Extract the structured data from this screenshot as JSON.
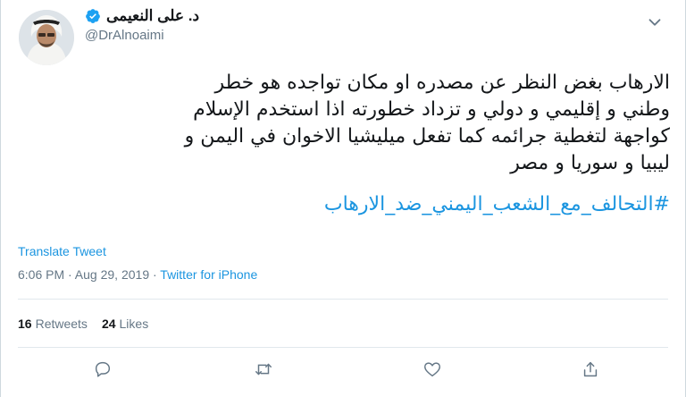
{
  "author": {
    "name": "د. على النعيمى",
    "handle": "@DrAlnoaimi"
  },
  "tweet": {
    "lines": [
      "الارهاب بغض النظر عن مصدره او مكان تواجده  هو خطر",
      "وطني و إقليمي و دولي و تزداد خطورته اذا  استخدم الإسلام",
      "كواجهة لتغطية جرائمه  كما تفعل ميليشيا الاخوان في اليمن و",
      "ليبيا و سوريا و مصر"
    ],
    "hashtag": "#التحالف_مع_الشعب_اليمني_ضد_الارهاب"
  },
  "translate_label": "Translate Tweet",
  "meta": {
    "time": "6:06 PM · Aug 29, 2019 · ",
    "app": "Twitter for iPhone"
  },
  "stats": {
    "retweets_count": "16",
    "retweets_label": "Retweets",
    "likes_count": "24",
    "likes_label": "Likes"
  },
  "colors": {
    "accent": "#1b95e0",
    "muted": "#657786",
    "verified": "#1da1f2"
  },
  "icons": {
    "menu": "chevron-down-icon",
    "verified": "verified-badge-icon",
    "reply": "reply-icon",
    "retweet": "retweet-icon",
    "like": "heart-icon",
    "share": "share-icon"
  }
}
